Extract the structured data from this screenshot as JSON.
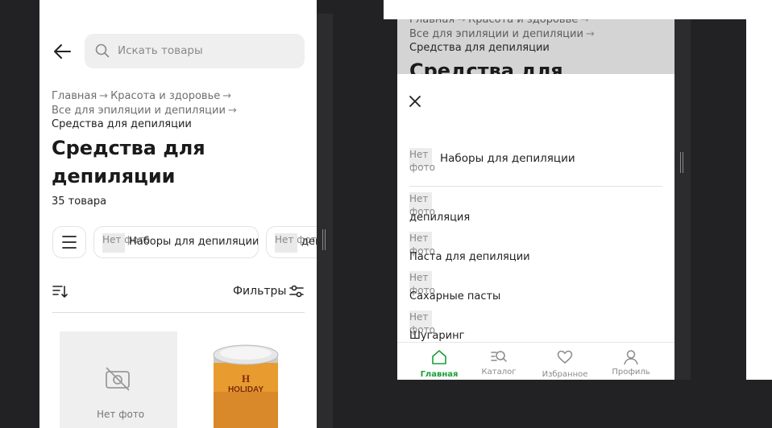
{
  "left": {
    "search": {
      "placeholder": "Искать товары"
    },
    "breadcrumbs": {
      "home": "Главная",
      "beauty": "Красота и здоровье",
      "epilation": "Все для эпиляции и депиляции",
      "current": "Средства для депиляции"
    },
    "arrow": "→",
    "title": "Средства для депиляции",
    "count": "35 товара",
    "chips": [
      {
        "no_photo": "Нет фото",
        "label": "Наборы для депиляции"
      },
      {
        "no_photo": "Нет фото",
        "label": "депиляция"
      }
    ],
    "filters_label": "Фильтры",
    "product_placeholder_text": "Нет фото",
    "product_brand": "HOLIDAY"
  },
  "right": {
    "breadcrumbs": {
      "home": "Главная",
      "beauty": "Красота и здоровье",
      "epilation": "Все для эпиляции и депиляции",
      "current": "Средства для депиляции"
    },
    "arrow": "→",
    "title": "Средства для",
    "categories": [
      {
        "no_photo": "Нет фото",
        "label": "Наборы для депиляции"
      },
      {
        "no_photo": "Нет фото",
        "label": "депиляция"
      },
      {
        "no_photo": "Нет фото",
        "label": "Паста для депиляции"
      },
      {
        "no_photo": "Нет фото",
        "label": "Сахарные пасты"
      },
      {
        "no_photo": "Нет фото",
        "label": "Шугаринг"
      }
    ],
    "tabbar": [
      {
        "label": "Главная",
        "icon": "home-icon",
        "active": true
      },
      {
        "label": "Каталог",
        "icon": "catalog-icon",
        "active": false
      },
      {
        "label": "Избранное",
        "icon": "heart-icon",
        "active": false
      },
      {
        "label": "Профиль",
        "icon": "profile-icon",
        "active": false
      }
    ]
  },
  "colors": {
    "accent": "#1b9e3a",
    "dark_bg": "#222224",
    "chip_border": "#e3e3e3",
    "overlay": "#d4d4d4"
  }
}
